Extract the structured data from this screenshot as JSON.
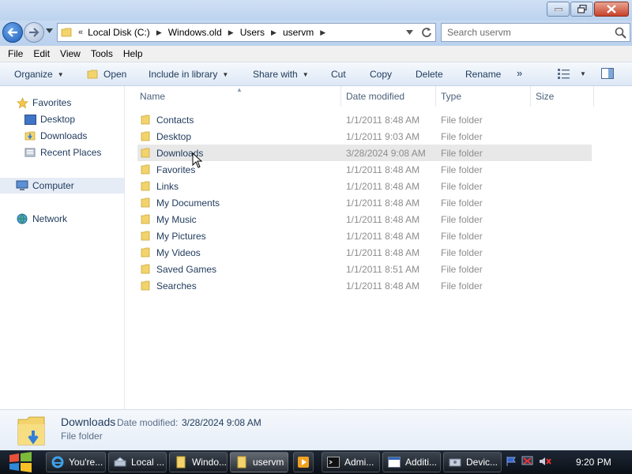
{
  "address": {
    "chevron": "«",
    "crumbs": [
      "Local Disk (C:)",
      "Windows.old",
      "Users",
      "uservm"
    ]
  },
  "search": {
    "placeholder": "Search uservm"
  },
  "menu": [
    "File",
    "Edit",
    "View",
    "Tools",
    "Help"
  ],
  "commands": {
    "organize": "Organize",
    "open": "Open",
    "include": "Include in library",
    "share": "Share with",
    "cut": "Cut",
    "copy": "Copy",
    "delete": "Delete",
    "rename": "Rename",
    "more": "»"
  },
  "navpane": {
    "favorites": "Favorites",
    "desktop": "Desktop",
    "downloads": "Downloads",
    "recent": "Recent Places",
    "computer": "Computer",
    "network": "Network"
  },
  "columns": {
    "name": "Name",
    "date": "Date modified",
    "type": "Type",
    "size": "Size"
  },
  "files": [
    {
      "name": "Contacts",
      "date": "1/1/2011 8:48 AM",
      "type": "File folder"
    },
    {
      "name": "Desktop",
      "date": "1/1/2011 9:03 AM",
      "type": "File folder"
    },
    {
      "name": "Downloads",
      "date": "3/28/2024 9:08 AM",
      "type": "File folder"
    },
    {
      "name": "Favorites",
      "date": "1/1/2011 8:48 AM",
      "type": "File folder"
    },
    {
      "name": "Links",
      "date": "1/1/2011 8:48 AM",
      "type": "File folder"
    },
    {
      "name": "My Documents",
      "date": "1/1/2011 8:48 AM",
      "type": "File folder"
    },
    {
      "name": "My Music",
      "date": "1/1/2011 8:48 AM",
      "type": "File folder"
    },
    {
      "name": "My Pictures",
      "date": "1/1/2011 8:48 AM",
      "type": "File folder"
    },
    {
      "name": "My Videos",
      "date": "1/1/2011 8:48 AM",
      "type": "File folder"
    },
    {
      "name": "Saved Games",
      "date": "1/1/2011 8:51 AM",
      "type": "File folder"
    },
    {
      "name": "Searches",
      "date": "1/1/2011 8:48 AM",
      "type": "File folder"
    }
  ],
  "details": {
    "name": "Downloads",
    "date_label": "Date modified:",
    "date": "3/28/2024 9:08 AM",
    "type": "File folder"
  },
  "taskbar": {
    "items": [
      "You're...",
      "Local ...",
      "Windo...",
      "uservm",
      "Admi...",
      "Additi...",
      "Devic..."
    ],
    "clock": "9:20 PM"
  },
  "colors": {
    "accent": "#1e395b",
    "folder": "#f3d36b",
    "hover_row": "#e8e8e8"
  }
}
